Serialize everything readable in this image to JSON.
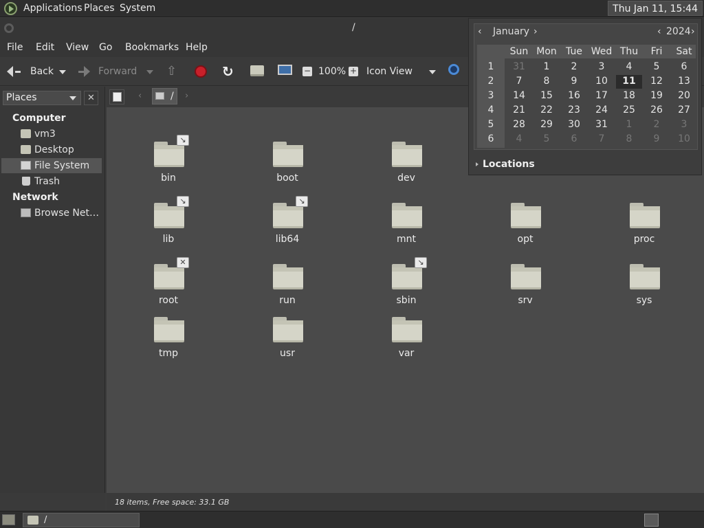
{
  "top_panel": {
    "menus": [
      "Applications",
      "Places",
      "System"
    ],
    "clock": "Thu Jan 11, 15:44"
  },
  "window": {
    "title": "/",
    "menubar": [
      "File",
      "Edit",
      "View",
      "Go",
      "Bookmarks",
      "Help"
    ],
    "toolbar": {
      "back": "Back",
      "forward": "Forward",
      "zoom": "100%",
      "view_mode": "Icon View"
    },
    "locbar": {
      "path_label": "/"
    },
    "sidebar": {
      "selector": "Places",
      "close": "✕",
      "sections": [
        {
          "title": "Computer",
          "items": [
            "vm3",
            "Desktop",
            "File System",
            "Trash"
          ]
        },
        {
          "title": "Network",
          "items": [
            "Browse Net…"
          ]
        }
      ],
      "selected_item": "File System"
    },
    "files": [
      {
        "name": "bin",
        "emblem": "↘"
      },
      {
        "name": "boot",
        "emblem": ""
      },
      {
        "name": "dev",
        "emblem": ""
      },
      {
        "name": "lib",
        "emblem": "↘"
      },
      {
        "name": "lib64",
        "emblem": "↘"
      },
      {
        "name": "mnt",
        "emblem": ""
      },
      {
        "name": "opt",
        "emblem": ""
      },
      {
        "name": "proc",
        "emblem": ""
      },
      {
        "name": "root",
        "emblem": "✕"
      },
      {
        "name": "run",
        "emblem": ""
      },
      {
        "name": "sbin",
        "emblem": "↘"
      },
      {
        "name": "srv",
        "emblem": ""
      },
      {
        "name": "sys",
        "emblem": ""
      },
      {
        "name": "tmp",
        "emblem": ""
      },
      {
        "name": "usr",
        "emblem": ""
      },
      {
        "name": "var",
        "emblem": ""
      }
    ],
    "status": "18 items, Free space: 33.1 GB"
  },
  "calendar": {
    "month": "January",
    "year": "2024",
    "weekdays": [
      "Sun",
      "Mon",
      "Tue",
      "Wed",
      "Thu",
      "Fri",
      "Sat"
    ],
    "weeks": [
      {
        "num": "1",
        "days": [
          "31",
          "1",
          "2",
          "3",
          "4",
          "5",
          "6"
        ]
      },
      {
        "num": "2",
        "days": [
          "7",
          "8",
          "9",
          "10",
          "11",
          "12",
          "13"
        ]
      },
      {
        "num": "3",
        "days": [
          "14",
          "15",
          "16",
          "17",
          "18",
          "19",
          "20"
        ]
      },
      {
        "num": "4",
        "days": [
          "21",
          "22",
          "23",
          "24",
          "25",
          "26",
          "27"
        ]
      },
      {
        "num": "5",
        "days": [
          "28",
          "29",
          "30",
          "31",
          "1",
          "2",
          "3"
        ]
      },
      {
        "num": "6",
        "days": [
          "4",
          "5",
          "6",
          "7",
          "8",
          "9",
          "10"
        ]
      }
    ],
    "today": "11",
    "locations_label": "Locations"
  },
  "bottom_panel": {
    "task_label": "/"
  }
}
